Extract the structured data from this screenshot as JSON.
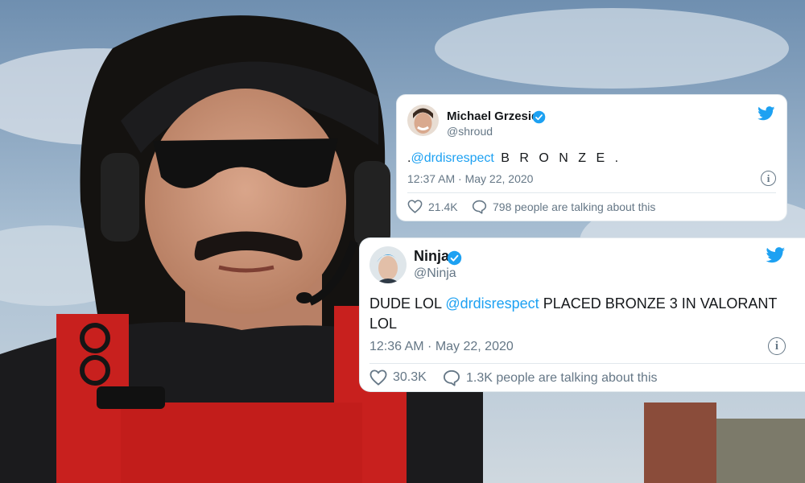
{
  "tweets": [
    {
      "name": "Michael Grzesiek",
      "handle": "@shroud",
      "text_prefix": ".",
      "mention": "@drdisrespect",
      "text_suffix": " B R O N Z E .",
      "time": "12:37 AM · May 22, 2020",
      "likes": "21.4K",
      "talking": "798 people are talking about this"
    },
    {
      "name": "Ninja",
      "handle": "@Ninja",
      "text_prefix": "DUDE LOL ",
      "mention": "@drdisrespect",
      "text_suffix": " PLACED BRONZE 3 IN VALORANT LOL",
      "time": "12:36 AM · May 22, 2020",
      "likes": "30.3K",
      "talking": "1.3K people are talking about this"
    }
  ],
  "icons": {
    "info": "i",
    "bird": "twitter-bird-icon",
    "verified": "verified-badge-icon",
    "like": "heart-icon",
    "reply": "speech-bubble-icon"
  },
  "colors": {
    "twitter_blue": "#1da1f2",
    "text": "#14171a",
    "muted": "#657786",
    "border": "#e1e8ed"
  }
}
